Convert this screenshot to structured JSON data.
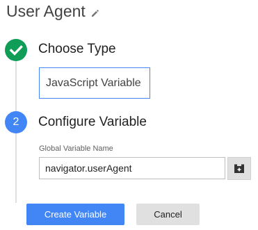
{
  "header": {
    "title": "User Agent",
    "edit_icon": "pencil-icon"
  },
  "step1": {
    "indicator_icon": "check-icon",
    "indicator_color": "#0f9d58",
    "title": "Choose Type",
    "selected_type": "JavaScript Variable"
  },
  "step2": {
    "number": "2",
    "indicator_color": "#4285f4",
    "title": "Configure Variable",
    "field_label": "Global Variable Name",
    "field_value": "navigator.userAgent",
    "picker_icon": "add-variable-icon"
  },
  "actions": {
    "create_label": "Create Variable",
    "cancel_label": "Cancel",
    "primary_color": "#4285f4"
  }
}
